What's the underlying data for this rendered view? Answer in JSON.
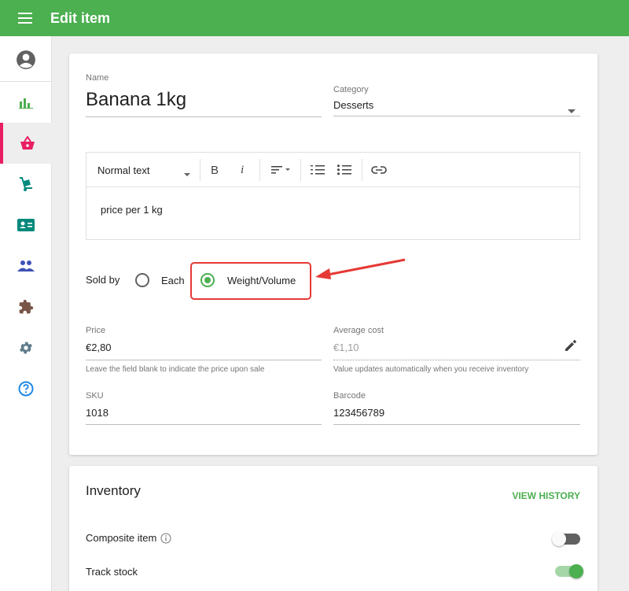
{
  "header": {
    "title": "Edit item"
  },
  "sidebar": {
    "items": [
      {
        "name": "account"
      },
      {
        "name": "reports"
      },
      {
        "name": "items"
      },
      {
        "name": "inventory"
      },
      {
        "name": "employees"
      },
      {
        "name": "customers"
      },
      {
        "name": "integrations"
      },
      {
        "name": "settings"
      },
      {
        "name": "help"
      }
    ]
  },
  "form": {
    "name_label": "Name",
    "name_value": "Banana 1kg",
    "category_label": "Category",
    "category_value": "Desserts",
    "editor": {
      "text_style": "Normal text",
      "bold": "B",
      "italic": "i",
      "content": "price per 1 kg"
    },
    "sold_by_label": "Sold by",
    "sold_by_options": [
      "Each",
      "Weight/Volume"
    ],
    "sold_by_selected": "Weight/Volume",
    "price_label": "Price",
    "price_value": "€2,80",
    "price_helper": "Leave the field blank to indicate the price upon sale",
    "avg_cost_label": "Average cost",
    "avg_cost_value": "€1,10",
    "avg_cost_helper": "Value updates automatically when you receive inventory",
    "sku_label": "SKU",
    "sku_value": "1018",
    "barcode_label": "Barcode",
    "barcode_value": "123456789"
  },
  "inventory": {
    "title": "Inventory",
    "view_history": "VIEW HISTORY",
    "composite_label": "Composite item",
    "composite_on": false,
    "track_stock_label": "Track stock",
    "track_stock_on": true
  },
  "colors": {
    "brand": "#4caf50",
    "active_nav": "#e91e63",
    "annotation": "#e53935"
  }
}
